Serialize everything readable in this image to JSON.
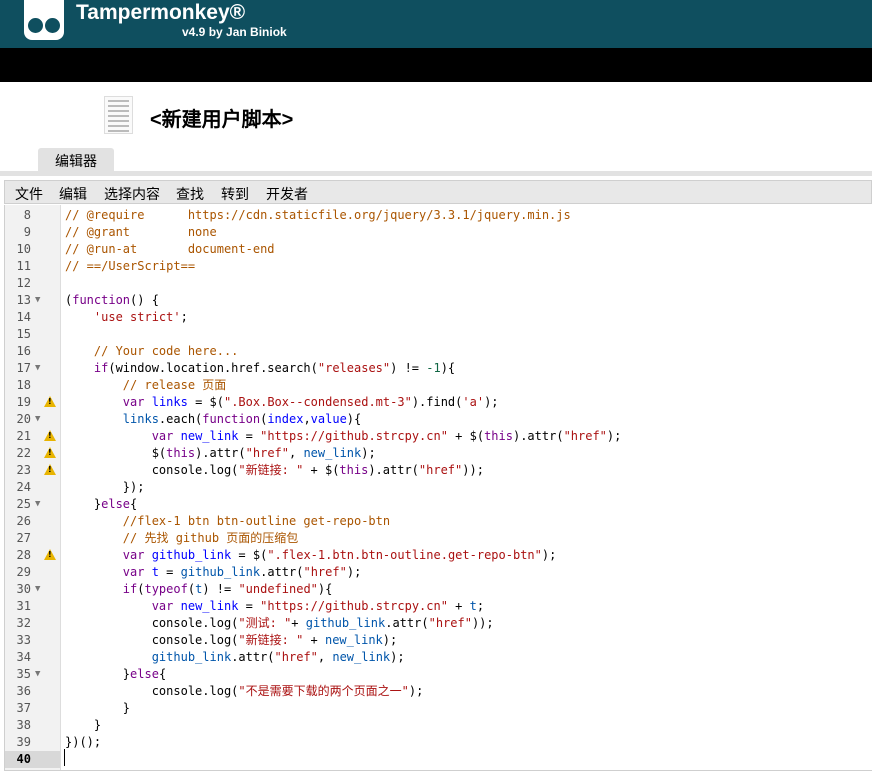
{
  "header": {
    "brand": "Tampermonkey®",
    "version": "v4.9 by Jan Biniok"
  },
  "page": {
    "title": "<新建用户脚本>"
  },
  "tabs": [
    {
      "label": "编辑器",
      "active": true
    }
  ],
  "menu": [
    "文件",
    "编辑",
    "选择内容",
    "查找",
    "转到",
    "开发者"
  ],
  "editor": {
    "active_line": 40,
    "lines": [
      {
        "n": 8,
        "warn": false,
        "fold": false,
        "toks": [
          [
            "cm",
            "// @require      https://cdn.staticfile.org/jquery/3.3.1/jquery.min.js"
          ]
        ]
      },
      {
        "n": 9,
        "warn": false,
        "fold": false,
        "toks": [
          [
            "cm",
            "// @grant        none"
          ]
        ]
      },
      {
        "n": 10,
        "warn": false,
        "fold": false,
        "toks": [
          [
            "cm",
            "// @run-at       document-end"
          ]
        ]
      },
      {
        "n": 11,
        "warn": false,
        "fold": false,
        "toks": [
          [
            "cm",
            "// ==/UserScript=="
          ]
        ]
      },
      {
        "n": 12,
        "warn": false,
        "fold": false,
        "toks": []
      },
      {
        "n": 13,
        "warn": false,
        "fold": true,
        "toks": [
          [
            "",
            "("
          ],
          [
            "kw",
            "function"
          ],
          [
            "",
            "() {"
          ]
        ]
      },
      {
        "n": 14,
        "warn": false,
        "fold": false,
        "toks": [
          [
            "",
            "    "
          ],
          [
            "st",
            "'use strict'"
          ],
          [
            "",
            ";"
          ]
        ]
      },
      {
        "n": 15,
        "warn": false,
        "fold": false,
        "toks": []
      },
      {
        "n": 16,
        "warn": false,
        "fold": false,
        "toks": [
          [
            "",
            "    "
          ],
          [
            "cm",
            "// Your code here..."
          ]
        ]
      },
      {
        "n": 17,
        "warn": false,
        "fold": true,
        "toks": [
          [
            "",
            "    "
          ],
          [
            "kw",
            "if"
          ],
          [
            "",
            "(window.location.href.search("
          ],
          [
            "st",
            "\"releases\""
          ],
          [
            "",
            ") != "
          ],
          [
            "nm",
            "-1"
          ],
          [
            "",
            "){"
          ]
        ]
      },
      {
        "n": 18,
        "warn": false,
        "fold": false,
        "toks": [
          [
            "",
            "        "
          ],
          [
            "cm",
            "// release 页面"
          ]
        ]
      },
      {
        "n": 19,
        "warn": true,
        "fold": false,
        "toks": [
          [
            "",
            "        "
          ],
          [
            "kw",
            "var"
          ],
          [
            "",
            " "
          ],
          [
            "vd",
            "links"
          ],
          [
            "",
            " = $("
          ],
          [
            "st",
            "\".Box.Box--condensed.mt-3\""
          ],
          [
            "",
            ").find("
          ],
          [
            "st",
            "'a'"
          ],
          [
            "",
            ");"
          ]
        ]
      },
      {
        "n": 20,
        "warn": false,
        "fold": true,
        "toks": [
          [
            "",
            "        "
          ],
          [
            "v2",
            "links"
          ],
          [
            "",
            ".each("
          ],
          [
            "kw",
            "function"
          ],
          [
            "",
            "("
          ],
          [
            "vd",
            "index"
          ],
          [
            "",
            ","
          ],
          [
            "vd",
            "value"
          ],
          [
            "",
            "){"
          ]
        ]
      },
      {
        "n": 21,
        "warn": true,
        "fold": false,
        "toks": [
          [
            "",
            "            "
          ],
          [
            "kw",
            "var"
          ],
          [
            "",
            " "
          ],
          [
            "vd",
            "new_link"
          ],
          [
            "",
            " = "
          ],
          [
            "st",
            "\"https://github.strcpy.cn\""
          ],
          [
            "",
            " + $("
          ],
          [
            "kw",
            "this"
          ],
          [
            "",
            ").attr("
          ],
          [
            "st",
            "\"href\""
          ],
          [
            "",
            ");"
          ]
        ]
      },
      {
        "n": 22,
        "warn": true,
        "fold": false,
        "toks": [
          [
            "",
            "            $("
          ],
          [
            "kw",
            "this"
          ],
          [
            "",
            ").attr("
          ],
          [
            "st",
            "\"href\""
          ],
          [
            "",
            ", "
          ],
          [
            "v2",
            "new_link"
          ],
          [
            "",
            ");"
          ]
        ]
      },
      {
        "n": 23,
        "warn": true,
        "fold": false,
        "toks": [
          [
            "",
            "            console.log("
          ],
          [
            "st",
            "\"新链接: \""
          ],
          [
            "",
            " + $("
          ],
          [
            "kw",
            "this"
          ],
          [
            "",
            ").attr("
          ],
          [
            "st",
            "\"href\""
          ],
          [
            "",
            "));"
          ]
        ]
      },
      {
        "n": 24,
        "warn": false,
        "fold": false,
        "toks": [
          [
            "",
            "        });"
          ]
        ]
      },
      {
        "n": 25,
        "warn": false,
        "fold": true,
        "toks": [
          [
            "",
            "    }"
          ],
          [
            "kw",
            "else"
          ],
          [
            "",
            "{"
          ]
        ]
      },
      {
        "n": 26,
        "warn": false,
        "fold": false,
        "toks": [
          [
            "",
            "        "
          ],
          [
            "cm",
            "//flex-1 btn btn-outline get-repo-btn"
          ]
        ]
      },
      {
        "n": 27,
        "warn": false,
        "fold": false,
        "toks": [
          [
            "",
            "        "
          ],
          [
            "cm",
            "// 先找 github 页面的压缩包"
          ]
        ]
      },
      {
        "n": 28,
        "warn": true,
        "fold": false,
        "toks": [
          [
            "",
            "        "
          ],
          [
            "kw",
            "var"
          ],
          [
            "",
            " "
          ],
          [
            "vd",
            "github_link"
          ],
          [
            "",
            " = $("
          ],
          [
            "st",
            "\".flex-1.btn.btn-outline.get-repo-btn\""
          ],
          [
            "",
            ");"
          ]
        ]
      },
      {
        "n": 29,
        "warn": false,
        "fold": false,
        "toks": [
          [
            "",
            "        "
          ],
          [
            "kw",
            "var"
          ],
          [
            "",
            " "
          ],
          [
            "vd",
            "t"
          ],
          [
            "",
            " = "
          ],
          [
            "v2",
            "github_link"
          ],
          [
            "",
            ".attr("
          ],
          [
            "st",
            "\"href\""
          ],
          [
            "",
            ");"
          ]
        ]
      },
      {
        "n": 30,
        "warn": false,
        "fold": true,
        "toks": [
          [
            "",
            "        "
          ],
          [
            "kw",
            "if"
          ],
          [
            "",
            "("
          ],
          [
            "kw",
            "typeof"
          ],
          [
            "",
            "("
          ],
          [
            "v2",
            "t"
          ],
          [
            "",
            ") != "
          ],
          [
            "st",
            "\"undefined\""
          ],
          [
            "",
            "){"
          ]
        ]
      },
      {
        "n": 31,
        "warn": false,
        "fold": false,
        "toks": [
          [
            "",
            "            "
          ],
          [
            "kw",
            "var"
          ],
          [
            "",
            " "
          ],
          [
            "vd",
            "new_link"
          ],
          [
            "",
            " = "
          ],
          [
            "st",
            "\"https://github.strcpy.cn\""
          ],
          [
            "",
            " + "
          ],
          [
            "v2",
            "t"
          ],
          [
            "",
            ";"
          ]
        ]
      },
      {
        "n": 32,
        "warn": false,
        "fold": false,
        "toks": [
          [
            "",
            "            console.log("
          ],
          [
            "st",
            "\"测试: \""
          ],
          [
            "",
            "+ "
          ],
          [
            "v2",
            "github_link"
          ],
          [
            "",
            ".attr("
          ],
          [
            "st",
            "\"href\""
          ],
          [
            "",
            "));"
          ]
        ]
      },
      {
        "n": 33,
        "warn": false,
        "fold": false,
        "toks": [
          [
            "",
            "            console.log("
          ],
          [
            "st",
            "\"新链接: \""
          ],
          [
            "",
            " + "
          ],
          [
            "v2",
            "new_link"
          ],
          [
            "",
            ");"
          ]
        ]
      },
      {
        "n": 34,
        "warn": false,
        "fold": false,
        "toks": [
          [
            "",
            "            "
          ],
          [
            "v2",
            "github_link"
          ],
          [
            "",
            ".attr("
          ],
          [
            "st",
            "\"href\""
          ],
          [
            "",
            ", "
          ],
          [
            "v2",
            "new_link"
          ],
          [
            "",
            ");"
          ]
        ]
      },
      {
        "n": 35,
        "warn": false,
        "fold": true,
        "toks": [
          [
            "",
            "        }"
          ],
          [
            "kw",
            "else"
          ],
          [
            "",
            "{"
          ]
        ]
      },
      {
        "n": 36,
        "warn": false,
        "fold": false,
        "toks": [
          [
            "",
            "            console.log("
          ],
          [
            "st",
            "\"不是需要下载的两个页面之一\""
          ],
          [
            "",
            ");"
          ]
        ]
      },
      {
        "n": 37,
        "warn": false,
        "fold": false,
        "toks": [
          [
            "",
            "        }"
          ]
        ]
      },
      {
        "n": 38,
        "warn": false,
        "fold": false,
        "toks": [
          [
            "",
            "    }"
          ]
        ]
      },
      {
        "n": 39,
        "warn": false,
        "fold": false,
        "toks": [
          [
            "",
            "})();"
          ]
        ]
      },
      {
        "n": 40,
        "warn": false,
        "fold": false,
        "toks": []
      }
    ]
  }
}
